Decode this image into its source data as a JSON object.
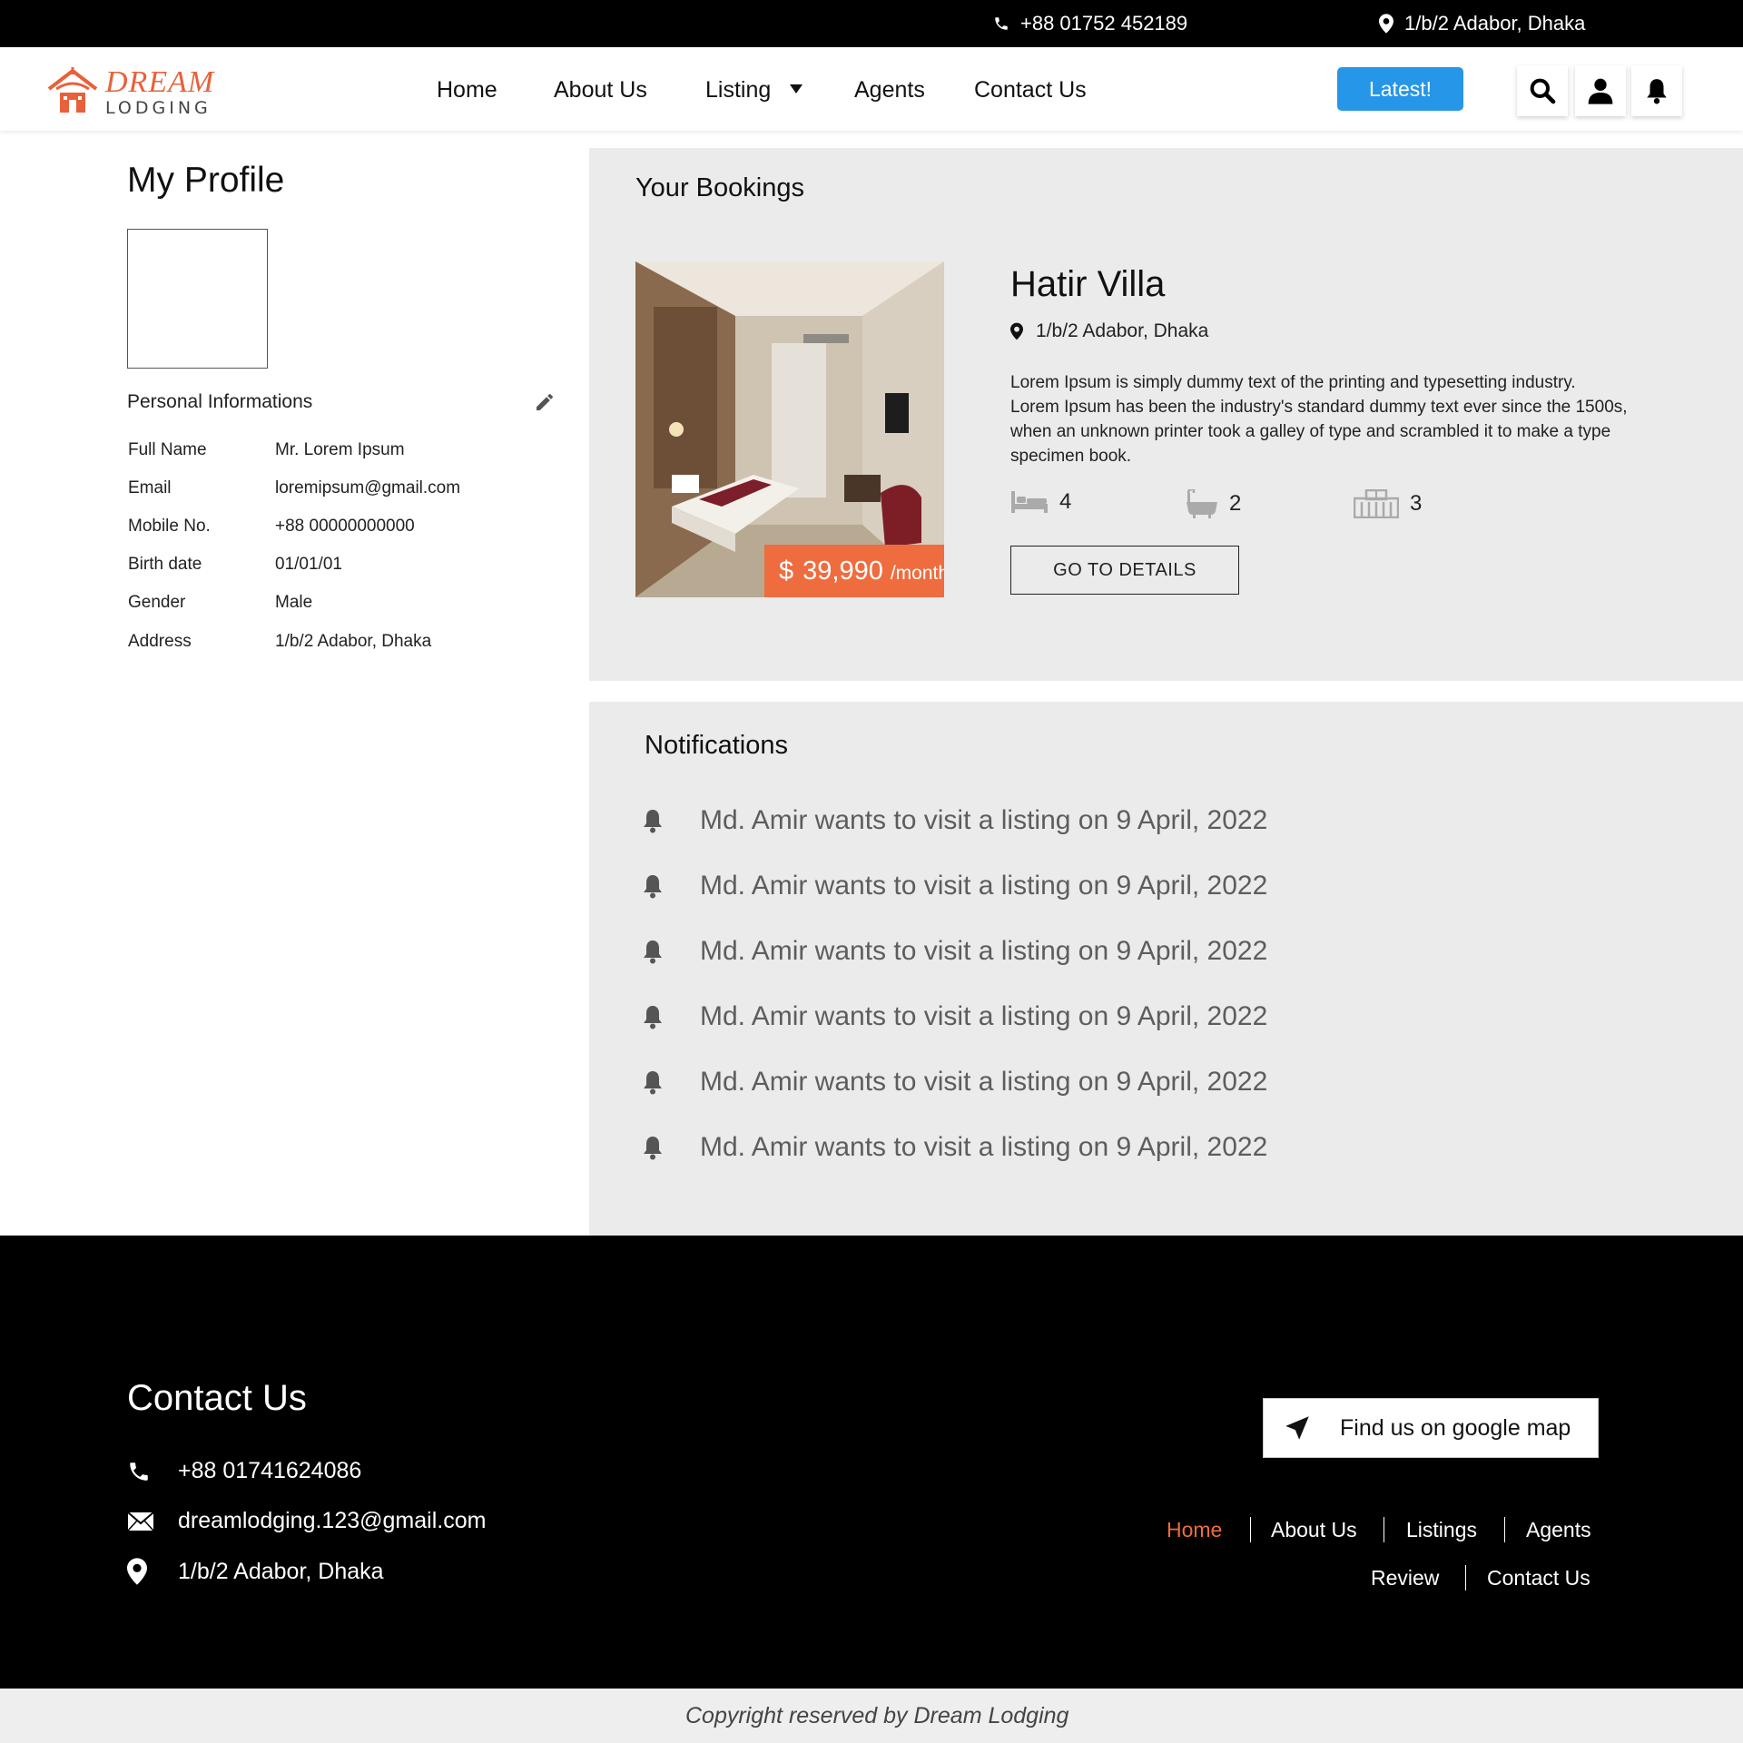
{
  "topbar": {
    "phone": "+88 01752 452189",
    "address": "1/b/2 Adabor, Dhaka"
  },
  "brand": {
    "name_top": "DREAM",
    "name_bottom": "LODGING",
    "accent_color": "#e8613a"
  },
  "nav": {
    "items": [
      "Home",
      "About Us",
      "Listing",
      "Agents",
      "Contact Us"
    ],
    "latest_label": "Latest!",
    "latest_color": "#2596e8",
    "icons": [
      "search-icon",
      "user-icon",
      "bell-icon"
    ]
  },
  "profile": {
    "title": "My Profile",
    "section_title": "Personal Informations",
    "fields": [
      {
        "label": "Full Name",
        "value": "Mr. Lorem Ipsum"
      },
      {
        "label": "Email",
        "value": "loremipsum@gmail.com"
      },
      {
        "label": "Mobile No.",
        "value": "+88 00000000000"
      },
      {
        "label": "Birth date",
        "value": "01/01/01"
      },
      {
        "label": "Gender",
        "value": "Male"
      },
      {
        "label": "Address",
        "value": "1/b/2 Adabor, Dhaka"
      }
    ]
  },
  "bookings": {
    "title": "Your Bookings",
    "item": {
      "name": "Hatir Villa",
      "location": "1/b/2 Adabor, Dhaka",
      "description": "Lorem Ipsum is simply dummy text of the printing and typesetting industry. Lorem Ipsum has been the industry's standard dummy text ever since the 1500s, when an unknown printer took a galley of type and scrambled it to make a type specimen book.",
      "price_currency": "$",
      "price_amount": "39,990",
      "price_period": "/month",
      "price_color": "#ef6c3e",
      "beds": "4",
      "baths": "2",
      "rooms": "3",
      "details_label": "GO TO DETAILS"
    }
  },
  "notifications": {
    "title": "Notifications",
    "items": [
      "Md. Amir wants to visit a listing on 9 April, 2022",
      "Md. Amir wants to visit a listing on 9 April, 2022",
      "Md. Amir wants to visit a listing on 9 April, 2022",
      "Md. Amir wants to visit a listing on 9 April, 2022",
      "Md. Amir wants to visit a listing on 9 April, 2022",
      "Md. Amir wants to visit a listing on 9 April, 2022"
    ]
  },
  "footer": {
    "title": "Contact Us",
    "phone": "+88 01741624086",
    "email": "dreamlodging.123@gmail.com",
    "address": "1/b/2 Adabor, Dhaka",
    "map_label": "Find us on google map",
    "links_row1": [
      "Home",
      "About Us",
      "Listings",
      "Agents"
    ],
    "links_row2": [
      "Review",
      "Contact Us"
    ],
    "copyright": "Copyright reserved by Dream Lodging"
  }
}
